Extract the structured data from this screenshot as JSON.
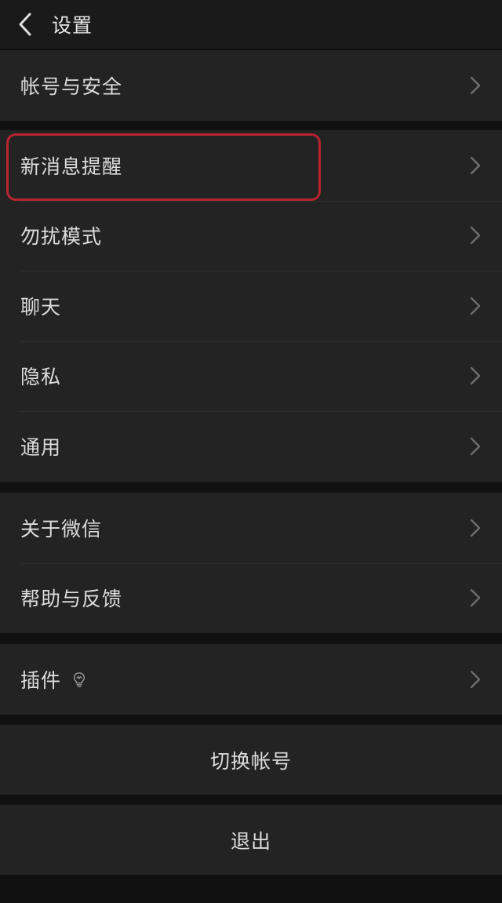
{
  "header": {
    "title": "设置",
    "back_icon": "chevron-left-icon"
  },
  "groups": [
    {
      "items": [
        {
          "label": "帐号与安全"
        }
      ]
    },
    {
      "items": [
        {
          "label": "新消息提醒",
          "highlighted": true
        },
        {
          "label": "勿扰模式"
        },
        {
          "label": "聊天"
        },
        {
          "label": "隐私"
        },
        {
          "label": "通用"
        }
      ]
    },
    {
      "items": [
        {
          "label": "关于微信"
        },
        {
          "label": "帮助与反馈"
        }
      ]
    },
    {
      "items": [
        {
          "label": "插件",
          "icon": "lightbulb-icon"
        }
      ]
    }
  ],
  "actions": {
    "switch_account": "切换帐号",
    "logout": "退出"
  },
  "colors": {
    "background": "#111111",
    "panel": "#232323",
    "text": "#dcdcdc",
    "chevron": "#6e6e6e",
    "highlight": "#b8242e"
  }
}
